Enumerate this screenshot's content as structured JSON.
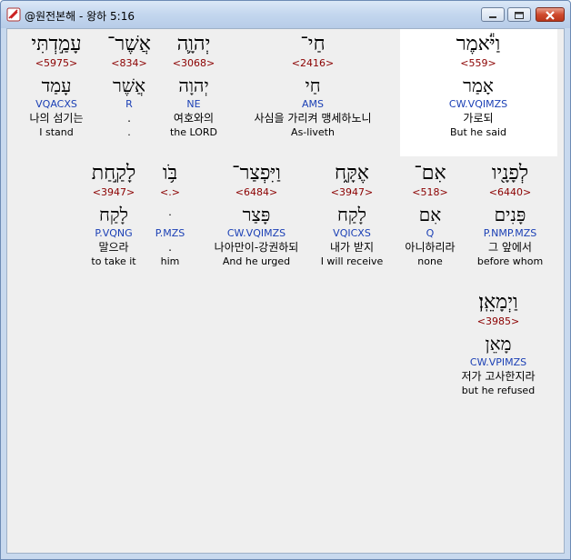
{
  "window": {
    "title": "@원전본해 - 왕하 5:16"
  },
  "words": [
    {
      "heb": "עָמַ֣דְתִּי",
      "strong": "<5975>",
      "lemma": "עָמַד",
      "parse": "VQACXS",
      "kor": "나의 섬기는",
      "eng": "I stand"
    },
    {
      "heb": "אֲשֶׁר־",
      "strong": "<834>",
      "lemma": "אֲשֶׁר",
      "parse": "R",
      "kor": ".",
      "eng": "."
    },
    {
      "heb": "יְהוָ֛ה",
      "strong": "<3068>",
      "lemma": "יְהוָה",
      "parse": "NE",
      "kor": "여호와의",
      "eng": "the LORD"
    },
    {
      "heb": "חַי־",
      "strong": "<2416>",
      "lemma": "חַי",
      "parse": "AMS",
      "kor": "사심을 가리켜 맹세하노니",
      "eng": "As-liveth"
    },
    {
      "heb": "וַיֹּ֕אמֶר",
      "strong": "<559>",
      "lemma": "אָמַר",
      "parse": "CW.VQIMZS",
      "kor": "가로되",
      "eng": "But he said"
    },
    {
      "heb": "לָקַ֣חַת",
      "strong": "<3947>",
      "lemma": "לָקַח",
      "parse": "P.VQNG",
      "kor": "말으라",
      "eng": "to take it"
    },
    {
      "heb": "בֹּ֥ו",
      "strong": "<.>",
      "lemma": "ּ",
      "parse": "P.MZS",
      "kor": ".",
      "eng": "him"
    },
    {
      "heb": "וַיִּפְצַר־",
      "strong": "<6484>",
      "lemma": "פָּצַר",
      "parse": "CW.VQIMZS",
      "kor": "나아만이-강권하되",
      "eng": "And he urged"
    },
    {
      "heb": "אֶקָּ֑ח",
      "strong": "<3947>",
      "lemma": "לָקַח",
      "parse": "VQICXS",
      "kor": "내가 받지",
      "eng": "I will receive"
    },
    {
      "heb": "אִם־",
      "strong": "<518>",
      "lemma": "אִם",
      "parse": "Q",
      "kor": "아니하리라",
      "eng": "none"
    },
    {
      "heb": "לְפָנָ֖יו",
      "strong": "<6440>",
      "lemma": "פָּנִים",
      "parse": "P.NMP.MZS",
      "kor": "그 앞에서",
      "eng": "before whom"
    },
    {
      "heb": "וַיְמָאֵֽן׃",
      "strong": "<3985>",
      "lemma": "מָאֵן",
      "parse": "CW.VPIMZS",
      "kor": "저가 고사한지라",
      "eng": "but he refused"
    }
  ]
}
